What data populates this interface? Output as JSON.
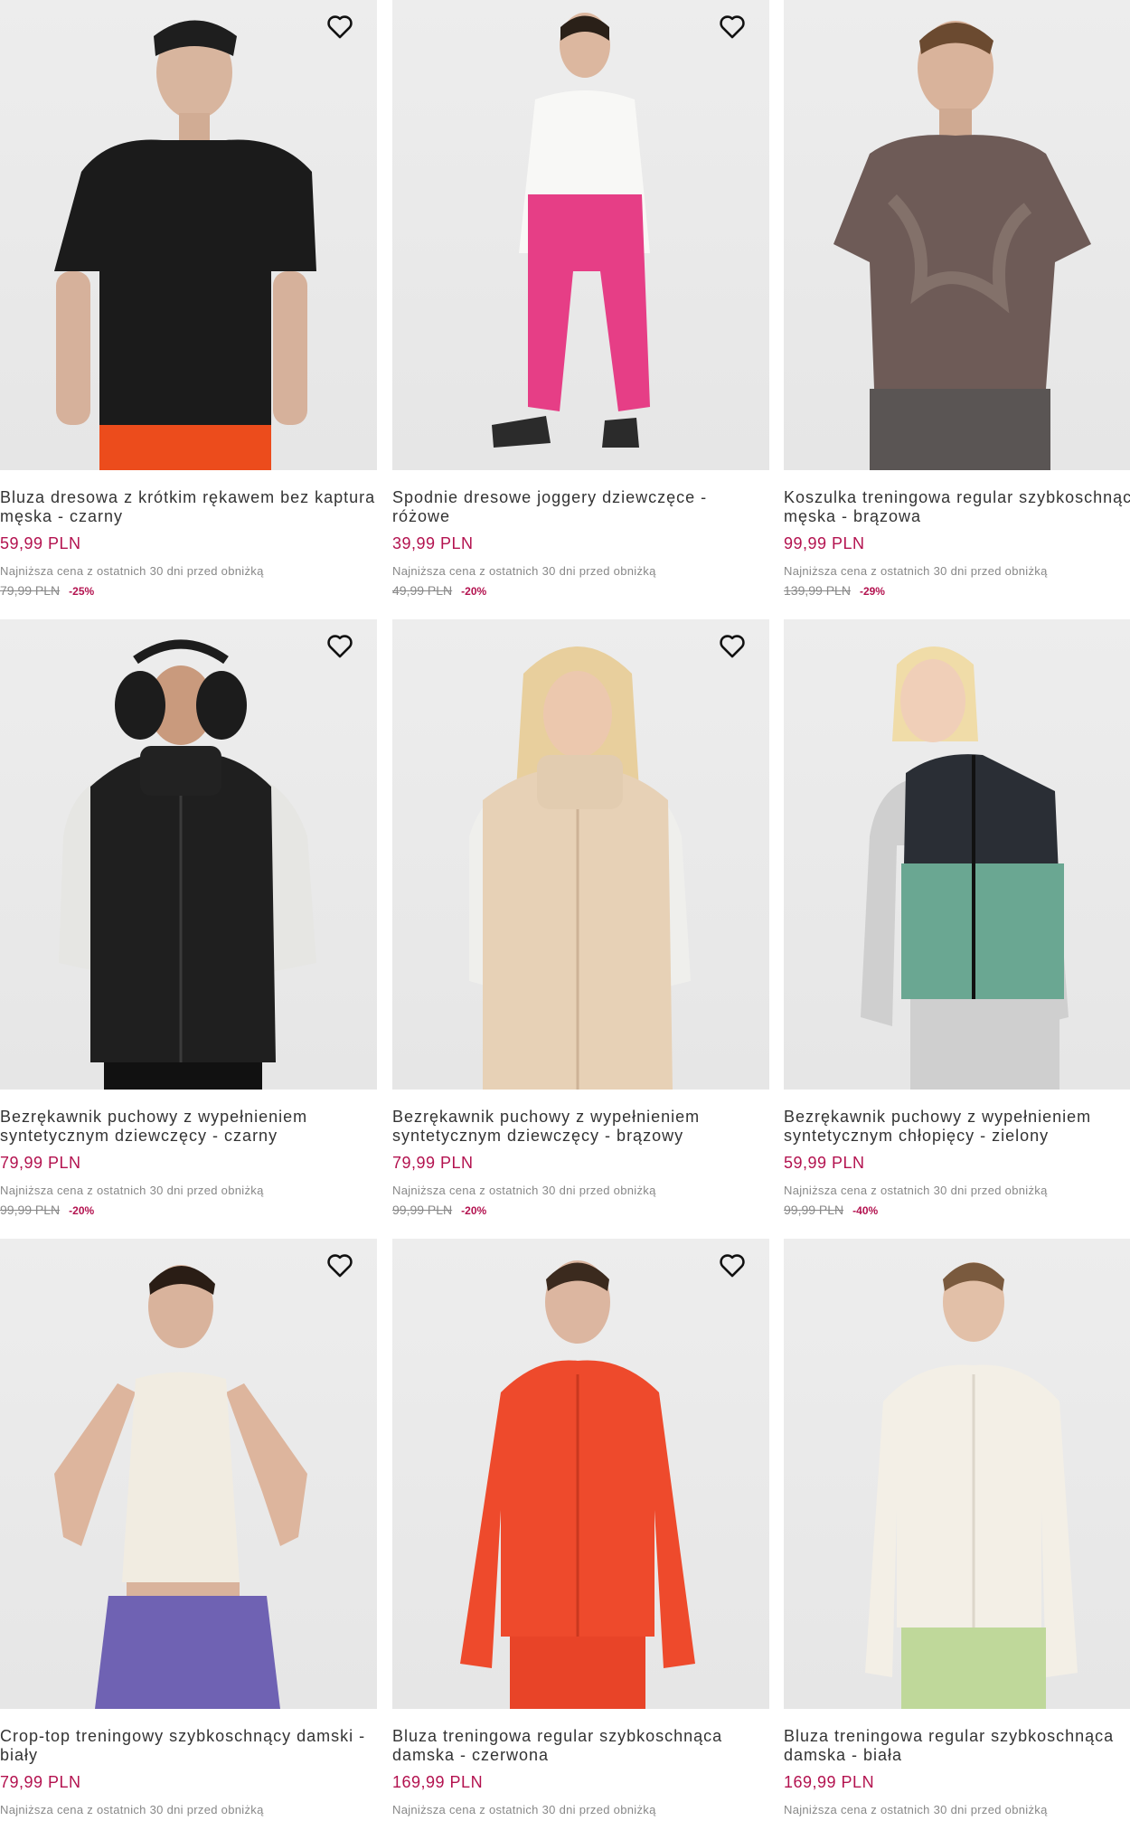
{
  "colors": {
    "price": "#b3124f",
    "discount": "#b3124f",
    "muted": "#888888",
    "image_bg": "#e9e9e9"
  },
  "icons": {
    "favorite": "heart-outline-icon"
  },
  "products": [
    {
      "name_line1": "Bluza dresowa z krótkim rękawem bez kaptura",
      "name_line2": "męska - czarny",
      "price": "59,99 PLN",
      "lowest_label": "Najniższa cena z ostatnich 30 dni przed obniżką",
      "old_price": "79,99 PLN",
      "discount": "-25%"
    },
    {
      "name_line1": "Spodnie dresowe joggery dziewczęce -",
      "name_line2": "różowe",
      "price": "39,99 PLN",
      "lowest_label": "Najniższa cena z ostatnich 30 dni przed obniżką",
      "old_price": "49,99 PLN",
      "discount": "-20%"
    },
    {
      "name_line1": "Koszulka treningowa regular szybkoschnąca",
      "name_line2": "męska - brązowa",
      "price": "99,99 PLN",
      "lowest_label": "Najniższa cena z ostatnich 30 dni przed obniżką",
      "old_price": "139,99 PLN",
      "discount": "-29%"
    },
    {
      "name_line1": "Bezrękawnik puchowy z wypełnieniem",
      "name_line2": "syntetycznym dziewczęcy - czarny",
      "price": "79,99 PLN",
      "lowest_label": "Najniższa cena z ostatnich 30 dni przed obniżką",
      "old_price": "99,99 PLN",
      "discount": "-20%"
    },
    {
      "name_line1": "Bezrękawnik puchowy z wypełnieniem",
      "name_line2": "syntetycznym dziewczęcy - brązowy",
      "price": "79,99 PLN",
      "lowest_label": "Najniższa cena z ostatnich 30 dni przed obniżką",
      "old_price": "99,99 PLN",
      "discount": "-20%"
    },
    {
      "name_line1": "Bezrękawnik puchowy z wypełnieniem",
      "name_line2": "syntetycznym chłopięcy - zielony",
      "price": "59,99 PLN",
      "lowest_label": "Najniższa cena z ostatnich 30 dni przed obniżką",
      "old_price": "99,99 PLN",
      "discount": "-40%"
    },
    {
      "name_line1": "Crop-top treningowy szybkoschnący damski -",
      "name_line2": "biały",
      "price": "79,99 PLN",
      "lowest_label": "Najniższa cena z ostatnich 30 dni przed obniżką",
      "old_price": "",
      "discount": ""
    },
    {
      "name_line1": "Bluza treningowa regular szybkoschnąca",
      "name_line2": "damska - czerwona",
      "price": "169,99 PLN",
      "lowest_label": "Najniższa cena z ostatnich 30 dni przed obniżką",
      "old_price": "",
      "discount": ""
    },
    {
      "name_line1": "Bluza treningowa regular szybkoschnąca",
      "name_line2": "damska - biała",
      "price": "169,99 PLN",
      "lowest_label": "Najniższa cena z ostatnich 30 dni przed obniżką",
      "old_price": "",
      "discount": ""
    }
  ]
}
